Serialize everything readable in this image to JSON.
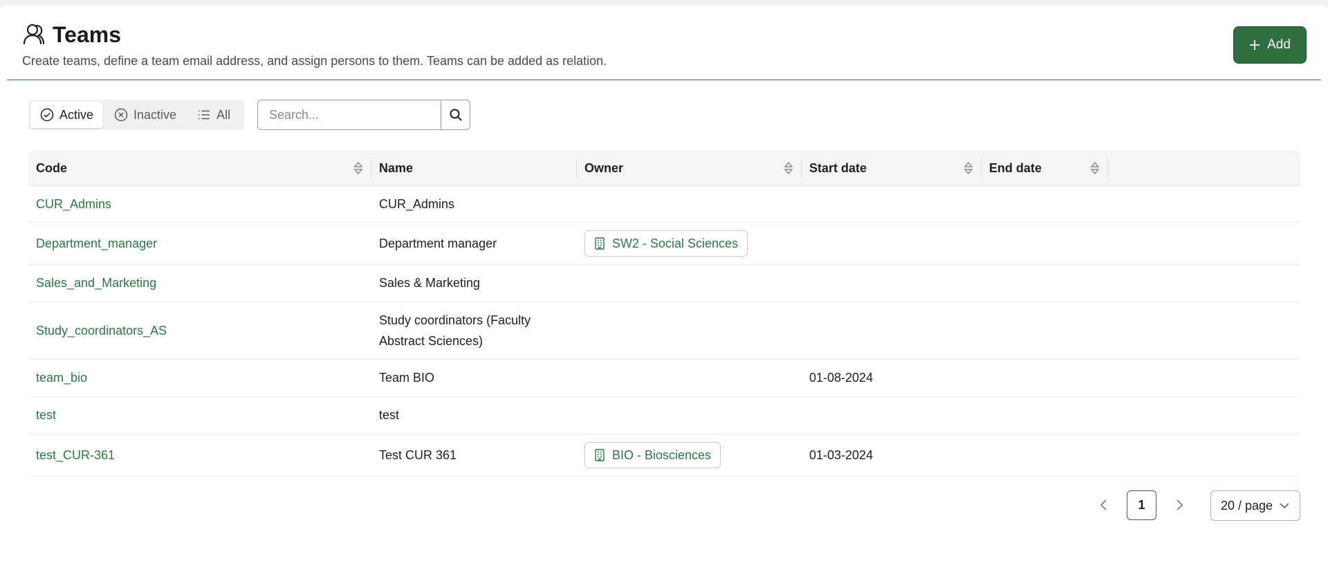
{
  "header": {
    "title": "Teams",
    "description": "Create teams, define a team email address, and assign persons to them. Teams can be added as relation.",
    "add_label": "Add",
    "title_icon": "team-icon"
  },
  "filters": {
    "segments": [
      {
        "label": "Active",
        "icon": "check-circle-icon",
        "selected": true
      },
      {
        "label": "Inactive",
        "icon": "x-circle-icon",
        "selected": false
      },
      {
        "label": "All",
        "icon": "list-icon",
        "selected": false
      }
    ],
    "search_placeholder": "Search..."
  },
  "table": {
    "columns": [
      "Code",
      "Name",
      "Owner",
      "Start date",
      "End date"
    ],
    "rows": [
      {
        "code": "CUR_Admins",
        "name": "CUR_Admins",
        "owner": "",
        "start_date": "",
        "end_date": ""
      },
      {
        "code": "Department_manager",
        "name": "Department manager",
        "owner": "SW2 - Social Sciences",
        "start_date": "",
        "end_date": ""
      },
      {
        "code": "Sales_and_Marketing",
        "name": "Sales & Marketing",
        "owner": "",
        "start_date": "",
        "end_date": ""
      },
      {
        "code": "Study_coordinators_AS",
        "name": "Study coordinators (Faculty",
        "name_line2": "Abstract Sciences)",
        "owner": "",
        "start_date": "",
        "end_date": ""
      },
      {
        "code": "team_bio",
        "name": "Team BIO",
        "owner": "",
        "start_date": "01-08-2024",
        "end_date": ""
      },
      {
        "code": "test",
        "name": "test",
        "owner": "",
        "start_date": "",
        "end_date": ""
      },
      {
        "code": "test_CUR-361",
        "name": "Test CUR 361",
        "owner": "BIO - Biosciences",
        "start_date": "01-03-2024",
        "end_date": ""
      }
    ]
  },
  "pagination": {
    "current_page": "1",
    "page_size_label": "20 / page"
  },
  "colors": {
    "accent": "#2e6e40",
    "link": "#2a7a40"
  }
}
